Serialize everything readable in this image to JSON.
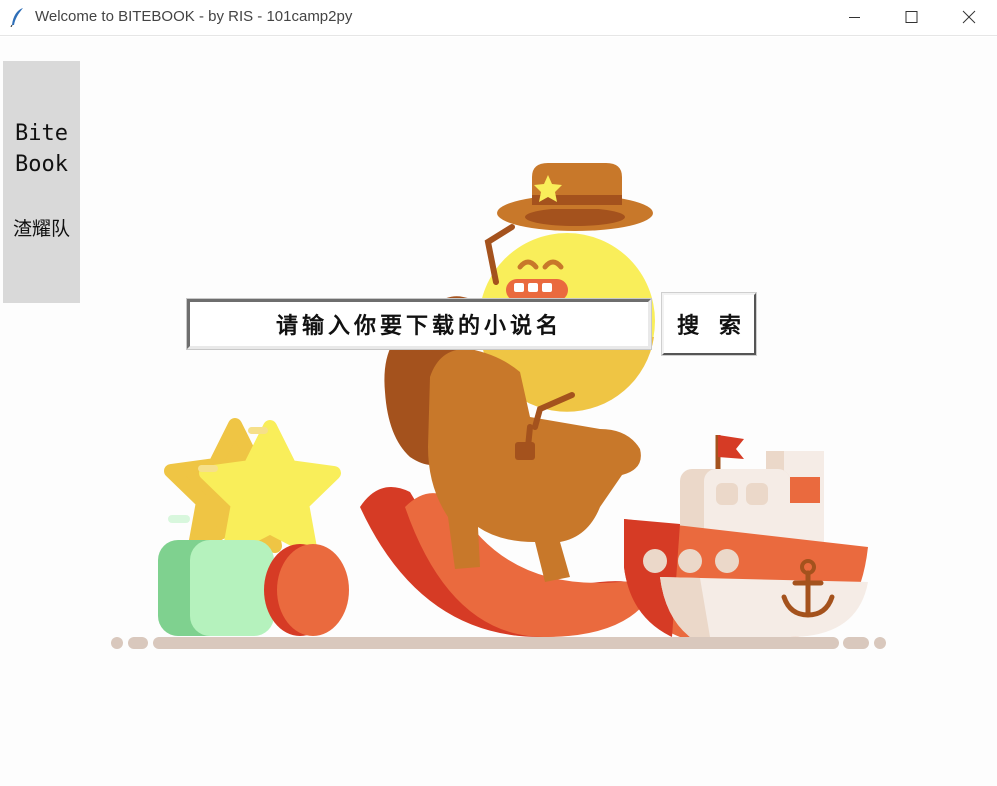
{
  "window": {
    "title": "Welcome to BITEBOOK - by RIS - 101camp2py",
    "icons": {
      "app": "feather-icon",
      "minimize": "minimize-icon",
      "maximize": "maximize-icon",
      "close": "close-icon"
    }
  },
  "sidebar": {
    "brand_line1": "Bite",
    "brand_line2": "Book",
    "team": "渣耀队"
  },
  "search": {
    "input_value": "请输入你要下载的小说名",
    "button_label": "搜 索"
  },
  "colors": {
    "sidebar_bg": "#d9d9d9",
    "sun": "#f9ee5a",
    "horse": "#c8782a",
    "rocker": "#ea6a3e",
    "cube": "#b5f2bd",
    "star": "#f9ee5a",
    "boat_hull": "#ea6a3e",
    "ground": "#d9c8bd"
  }
}
